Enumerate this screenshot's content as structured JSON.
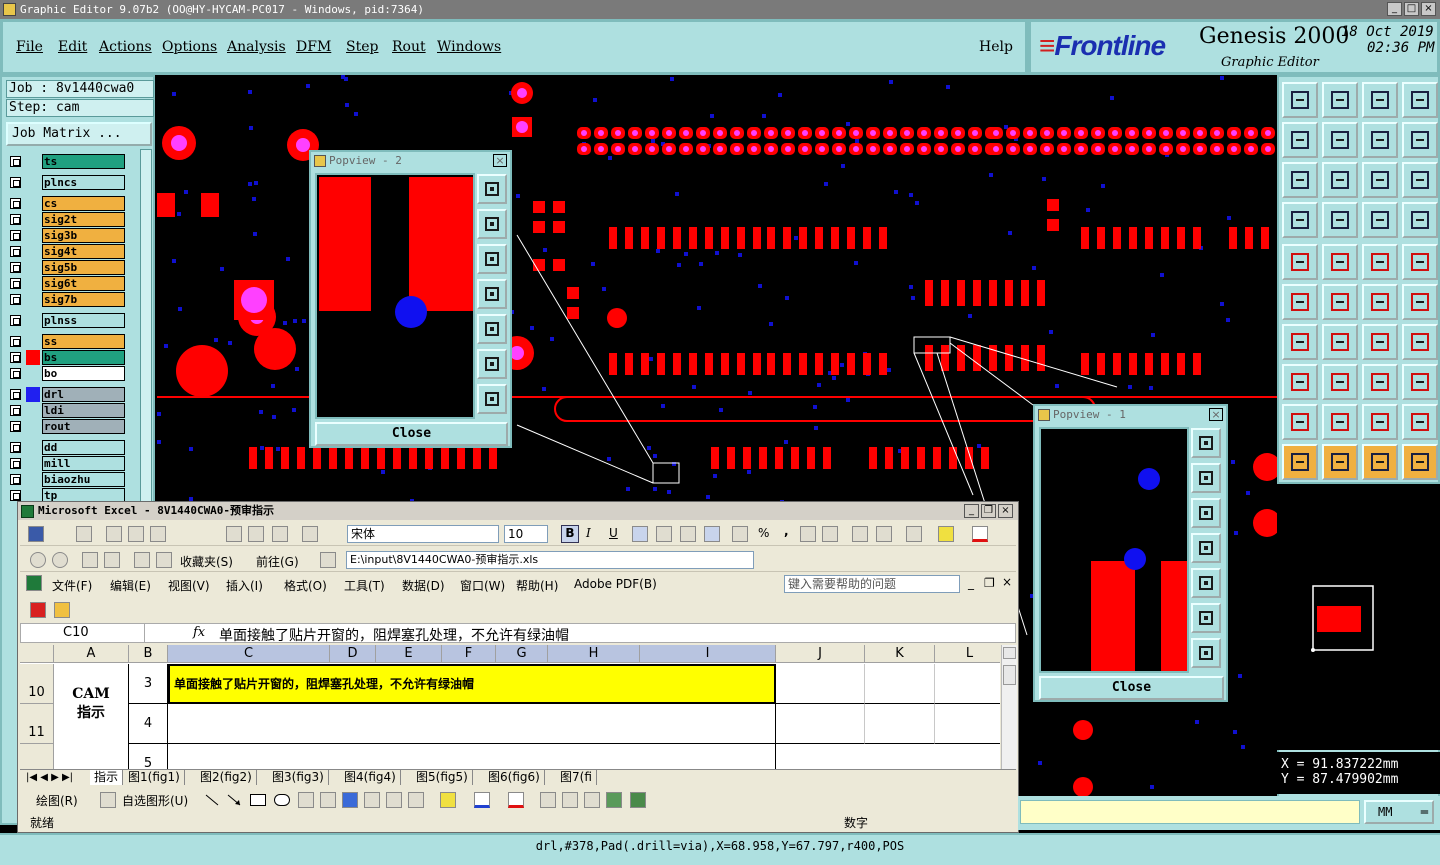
{
  "window": {
    "title": "Graphic Editor 9.07b2 (OO@HY-HYCAM-PC017 - Windows, pid:7364)"
  },
  "menu": {
    "items": [
      "File",
      "Edit",
      "Actions",
      "Options",
      "Analysis",
      "DFM",
      "Step",
      "Rout",
      "Windows"
    ],
    "help": "Help"
  },
  "brand": {
    "logo": "Frontline",
    "product": "Genesis 2000",
    "subtitle": "Graphic Editor",
    "date": "18 Oct 2019",
    "time": "02:36 PM"
  },
  "job": {
    "job_label": "Job : 8v1440cwa0",
    "step_label": "Step: cam",
    "matrix_button": "Job Matrix ..."
  },
  "layers": [
    {
      "name": "ts",
      "color": "#20a080"
    },
    {
      "name": "plncs",
      "color": "#aee0e0"
    },
    {
      "name": "cs",
      "color": "#f0b040"
    },
    {
      "name": "sig2t",
      "color": "#f0b040"
    },
    {
      "name": "sig3b",
      "color": "#f0b040"
    },
    {
      "name": "sig4t",
      "color": "#f0b040"
    },
    {
      "name": "sig5b",
      "color": "#f0b040"
    },
    {
      "name": "sig6t",
      "color": "#f0b040"
    },
    {
      "name": "sig7b",
      "color": "#f0b040"
    },
    {
      "name": "plnss",
      "color": "#aee0e0"
    },
    {
      "name": "ss",
      "color": "#f0b040"
    },
    {
      "name": "bs",
      "color": "#20a080"
    },
    {
      "name": "bo",
      "color": "#ffffff"
    },
    {
      "name": "drl",
      "color": "#a0b0b8"
    },
    {
      "name": "ldi",
      "color": "#a0b0b8"
    },
    {
      "name": "rout",
      "color": "#a0b0b8"
    },
    {
      "name": "dd",
      "color": "#aee0e0"
    },
    {
      "name": "mill",
      "color": "#aee0e0"
    },
    {
      "name": "biaozhu",
      "color": "#aee0e0"
    },
    {
      "name": "tp",
      "color": "#aee0e0"
    }
  ],
  "popview2": {
    "title": "Popview - 2",
    "close_label": "Close"
  },
  "popview1": {
    "title": "Popview - 1",
    "close_label": "Close"
  },
  "coords": {
    "x": "X  =  91.837222mm",
    "y": "Y  =  87.479902mm"
  },
  "units": {
    "value": "MM"
  },
  "status": {
    "text": "drl,#378,Pad(.drill=via),X=68.958,Y=67.797,r400,POS"
  },
  "excel": {
    "title": "Microsoft Excel - 8V1440CWA0-预审指示",
    "font_name": "宋体",
    "font_size": "10",
    "favorites": "收藏夹(S)",
    "goto": "前往(G)",
    "path": "E:\\input\\8V1440CWA0-预审指示.xls",
    "menus": [
      "文件(F)",
      "编辑(E)",
      "视图(V)",
      "插入(I)",
      "格式(O)",
      "工具(T)",
      "数据(D)",
      "窗口(W)",
      "帮助(H)",
      "Adobe PDF(B)"
    ],
    "help_placeholder": "键入需要帮助的问题",
    "name_box": "C10",
    "formula": "单面接触了贴片开窗的，阻焊塞孔处理，不允许有绿油帽",
    "columns": [
      "A",
      "B",
      "C",
      "D",
      "E",
      "F",
      "G",
      "H",
      "I",
      "J",
      "K",
      "L"
    ],
    "rows": [
      {
        "num": "10",
        "b": "3",
        "c": "单面接触了贴片开窗的，阻焊塞孔处理，不允许有绿油帽"
      },
      {
        "num": "11",
        "b": "4",
        "c": ""
      },
      {
        "num": "",
        "b": "5",
        "c": ""
      }
    ],
    "merged_a": "CAM\n指示",
    "sheet_tabs": [
      "指示",
      "图1(fig1)",
      "图2(fig2)",
      "图3(fig3)",
      "图4(fig4)",
      "图5(fig5)",
      "图6(fig6)",
      "图7(fi"
    ],
    "draw_label": "绘图(R)",
    "autoshape_label": "自选图形(U)",
    "status_left": "就绪",
    "status_right": "数字",
    "format_b": "B",
    "format_i": "I",
    "format_u": "U",
    "percent": "%",
    "comma": ",",
    "fx": "fx"
  }
}
